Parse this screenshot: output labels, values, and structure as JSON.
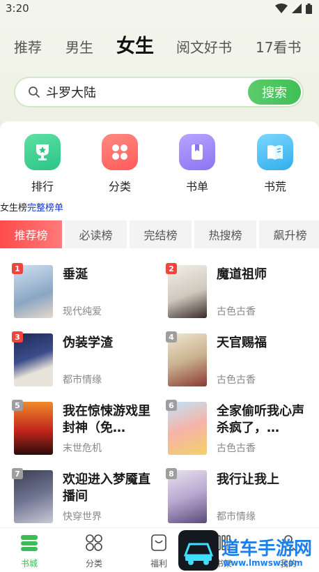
{
  "status": {
    "time": "3:20"
  },
  "channels": [
    {
      "label": "推荐"
    },
    {
      "label": "男生"
    },
    {
      "label": "女生",
      "active": true
    },
    {
      "label": "阅文好书"
    },
    {
      "label": "17看书"
    }
  ],
  "search": {
    "value": "斗罗大陆",
    "button": "搜索"
  },
  "quick_actions": [
    {
      "label": "排行",
      "icon": "trophy-icon",
      "color": "#34c98a"
    },
    {
      "label": "分类",
      "icon": "grid-icon",
      "color": "#ff6b6b"
    },
    {
      "label": "书单",
      "icon": "bookmark-icon",
      "color": "#9a82f5"
    },
    {
      "label": "书荒",
      "icon": "book-icon",
      "color": "#3fb8f0"
    }
  ],
  "rank_caption": {
    "text": "女生榜",
    "link": "完整榜单"
  },
  "rank_tabs": [
    {
      "label": "推荐榜",
      "active": true
    },
    {
      "label": "必读榜"
    },
    {
      "label": "完结榜"
    },
    {
      "label": "热搜榜"
    },
    {
      "label": "飙升榜"
    }
  ],
  "books": [
    {
      "rank": "1",
      "title": "垂涎",
      "genre": "现代纯爱",
      "badge_color": "#f0443f"
    },
    {
      "rank": "2",
      "title": "魔道祖师",
      "genre": "古色古香",
      "badge_color": "#f0443f"
    },
    {
      "rank": "3",
      "title": "伪装学渣",
      "genre": "都市情缘",
      "badge_color": "#f0443f"
    },
    {
      "rank": "4",
      "title": "天官赐福",
      "genre": "古色古香",
      "badge_color": "#9e9e9e"
    },
    {
      "rank": "5",
      "title": "我在惊悚游戏里封神（免…",
      "genre": "末世危机",
      "badge_color": "#9e9e9e"
    },
    {
      "rank": "6",
      "title": "全家偷听我心声杀疯了，…",
      "genre": "古色古香",
      "badge_color": "#9e9e9e"
    },
    {
      "rank": "7",
      "title": "欢迎进入梦魇直播间",
      "genre": "快穿世界",
      "badge_color": "#9e9e9e"
    },
    {
      "rank": "8",
      "title": "我行让我上",
      "genre": "都市情缘",
      "badge_color": "#9e9e9e"
    }
  ],
  "nav": [
    {
      "label": "书城",
      "icon": "bookshelf-stack-icon",
      "active": true
    },
    {
      "label": "分类",
      "icon": "circles-grid-icon"
    },
    {
      "label": "福利",
      "icon": "gift-box-icon"
    },
    {
      "label": "书架",
      "icon": "shelf-icon"
    },
    {
      "label": "我的",
      "icon": "person-icon"
    }
  ],
  "watermark": {
    "text": "道车手游网",
    "url": "www.lmwsw.com"
  }
}
